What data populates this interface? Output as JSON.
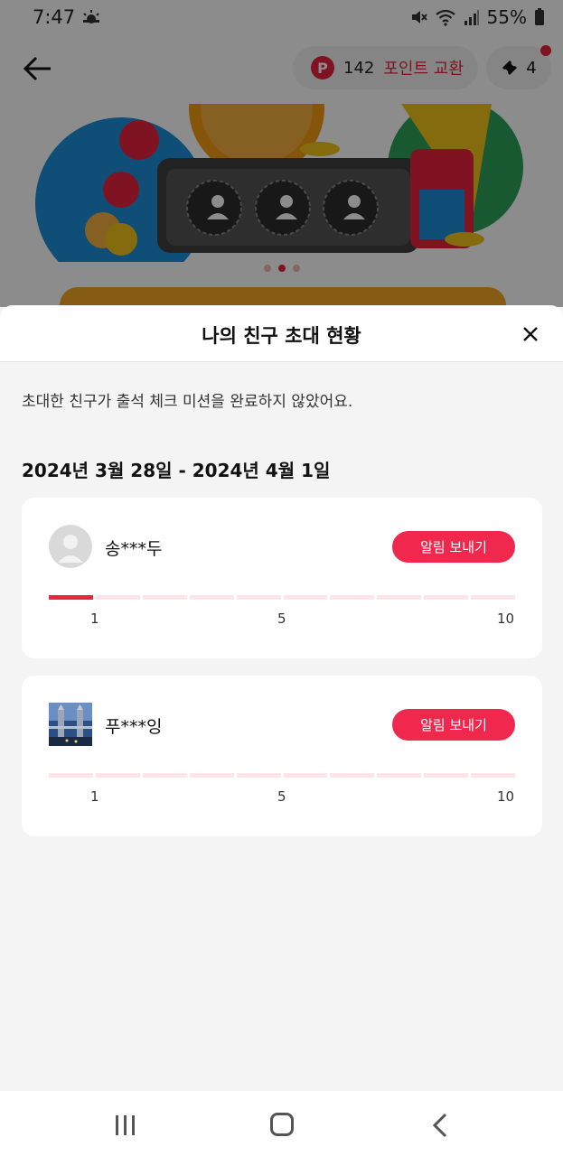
{
  "status_bar": {
    "time": "7:47",
    "battery": "55%",
    "icons": [
      "weather-icon",
      "mute-icon",
      "wifi-icon",
      "signal-icon",
      "battery-icon"
    ]
  },
  "header": {
    "points_badge": "P",
    "points_value": "142",
    "points_label": "포인트 교환",
    "ticket_count": "4",
    "accent_color": "#e8243f"
  },
  "banner": {
    "page_count": 3,
    "active_page": 2
  },
  "sheet": {
    "title": "나의 친구 초대 현황",
    "notice": "초대한 친구가 출석 체크 미션을 완료하지 않았어요.",
    "date_range": "2024년 3월 28일 - 2024년 4월 1일",
    "friends": [
      {
        "name": "송***두",
        "button_label": "알림 보내기",
        "progress": 1,
        "progress_max": 10,
        "ticks": [
          "1",
          "5",
          "10"
        ]
      },
      {
        "name": "푸***잉",
        "button_label": "알림 보내기",
        "progress": 0,
        "progress_max": 10,
        "ticks": [
          "1",
          "5",
          "10"
        ]
      }
    ]
  },
  "nav": {
    "icons": [
      "recent-apps-icon",
      "home-icon",
      "back-icon"
    ]
  }
}
